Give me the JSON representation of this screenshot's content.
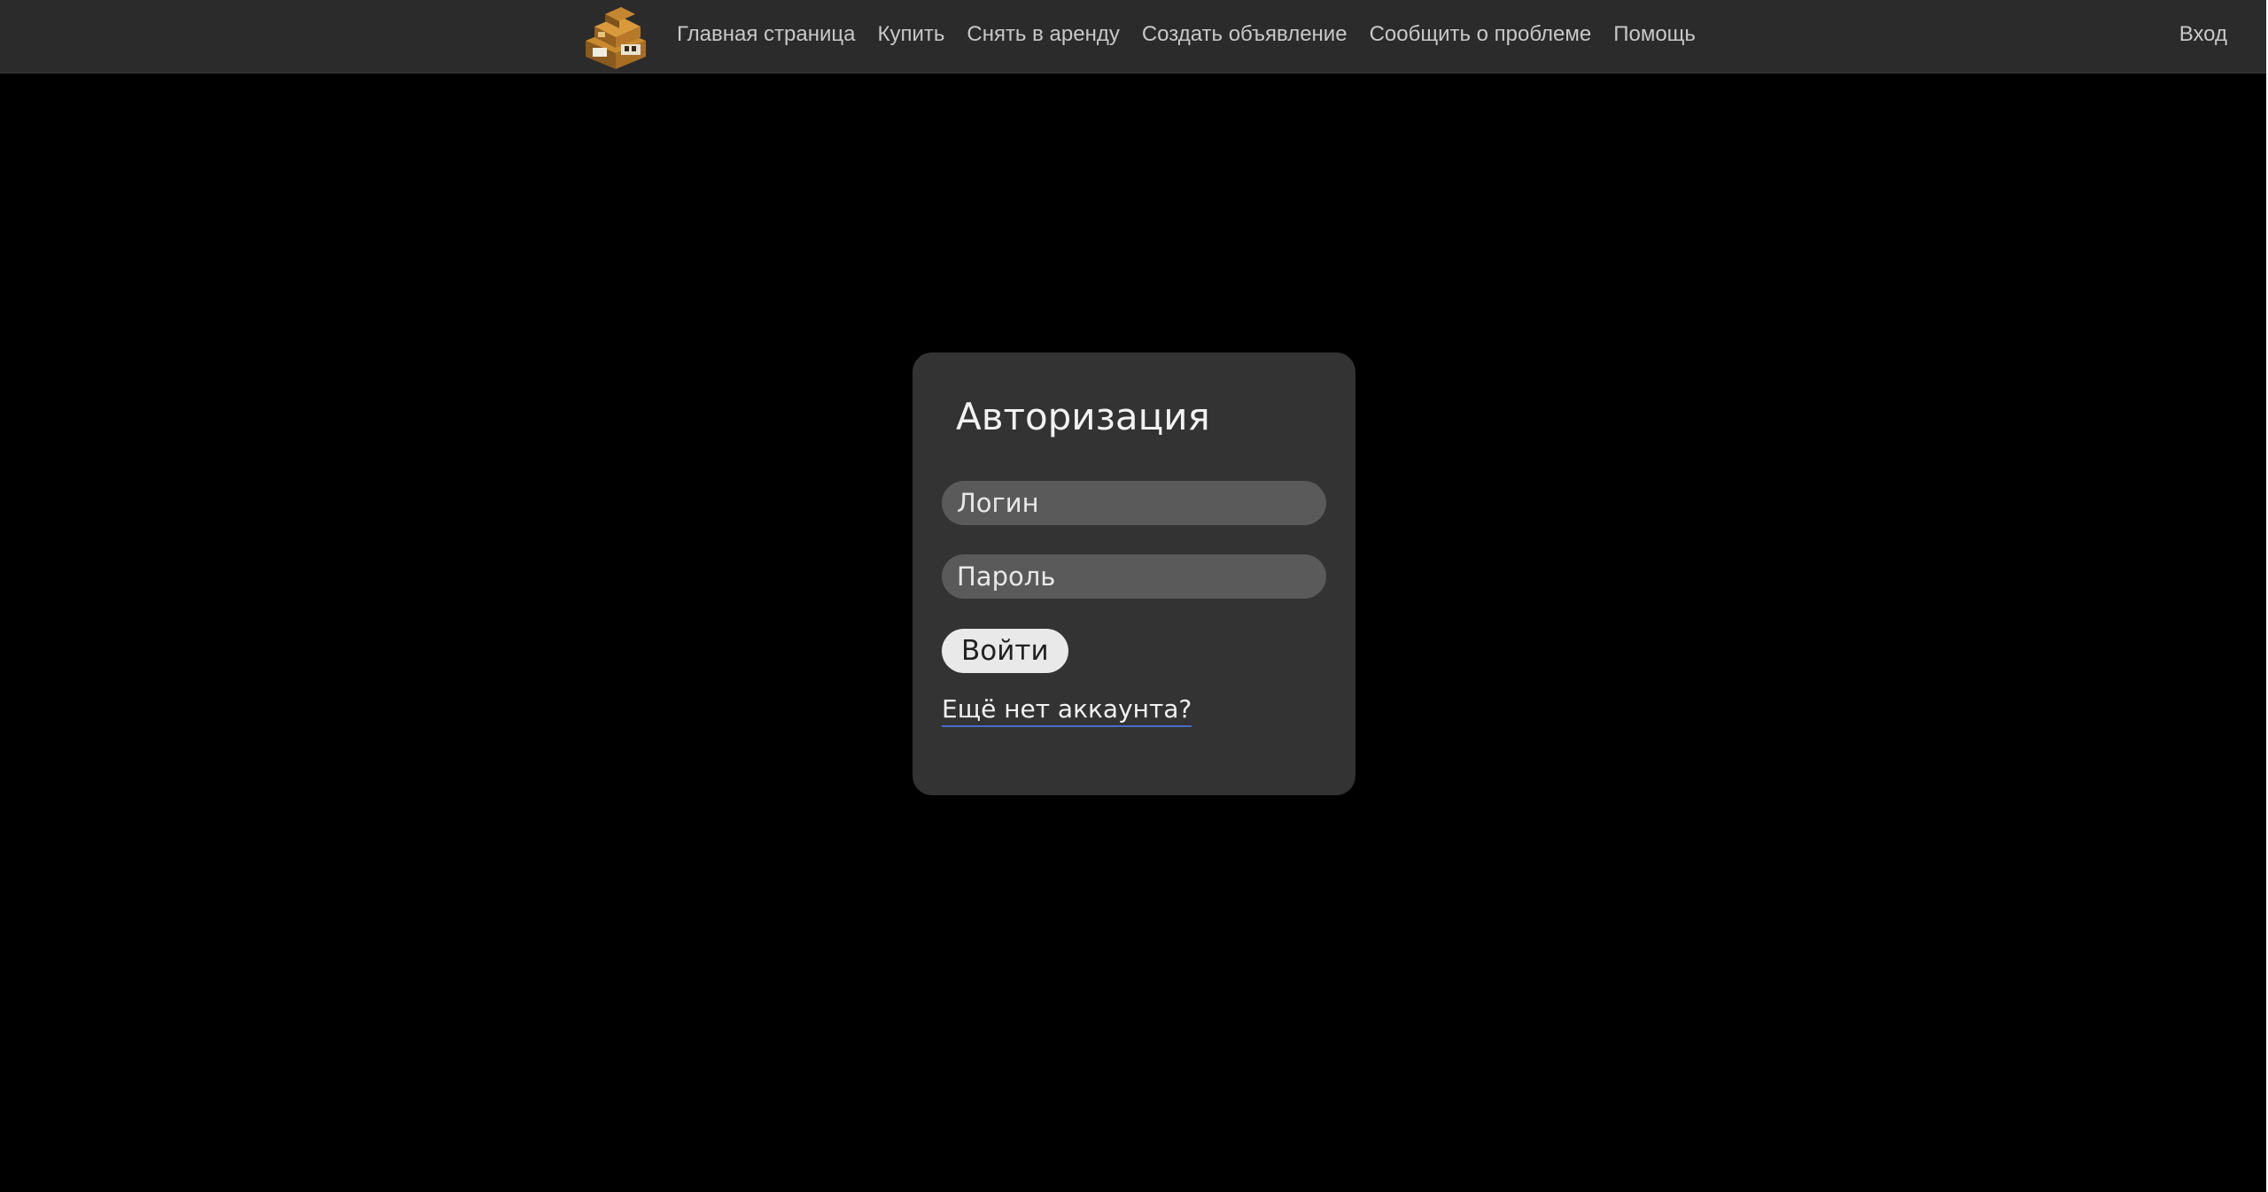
{
  "navbar": {
    "logo_icon": "house-logo-icon",
    "links": [
      {
        "label": "Главная страница"
      },
      {
        "label": "Купить"
      },
      {
        "label": "Снять в аренду"
      },
      {
        "label": "Создать объявление"
      },
      {
        "label": "Сообщить о проблеме"
      },
      {
        "label": "Помощь"
      }
    ],
    "login_label": "Вход"
  },
  "auth": {
    "title": "Авторизация",
    "login_placeholder": "Логин",
    "password_placeholder": "Пароль",
    "submit_label": "Войти",
    "register_link": "Ещё нет аккаунта?"
  },
  "colors": {
    "page_background": "#000000",
    "navbar_background": "#2b2b2b",
    "card_background": "#333333",
    "input_background": "#5a5a5a",
    "button_background": "#e9e9e9",
    "link_underline": "#4a6cc8"
  }
}
